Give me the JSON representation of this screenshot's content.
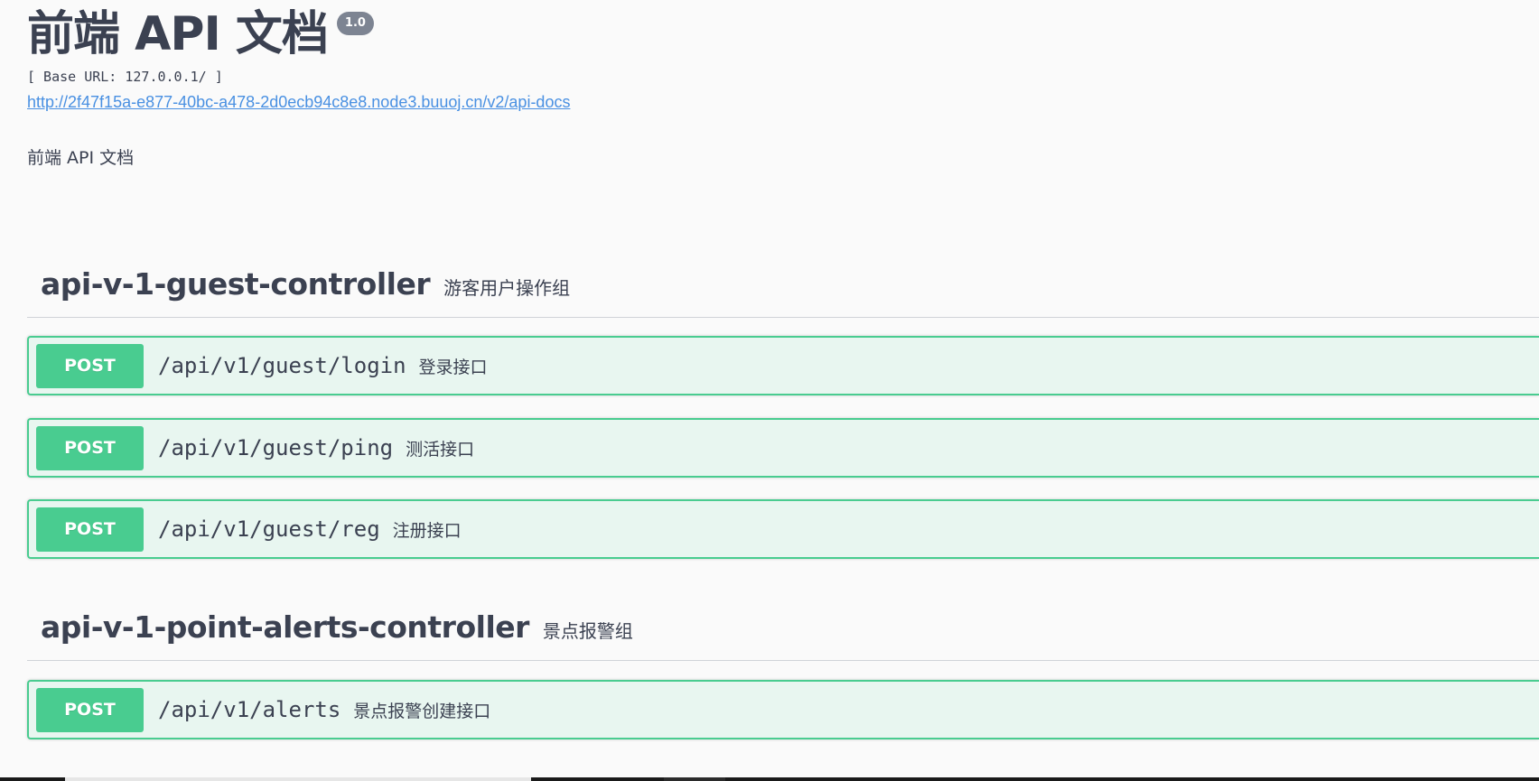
{
  "info": {
    "title": "前端 API 文档",
    "version": "1.0",
    "base_url": "[ Base URL: 127.0.0.1/ ]",
    "api_docs_link": "http://2f47f15a-e877-40bc-a478-2d0ecb94c8e8.node3.buuoj.cn/v2/api-docs",
    "description": "前端 API 文档"
  },
  "tags": [
    {
      "name": "api-v-1-guest-controller",
      "description": "游客用户操作组",
      "operations": [
        {
          "method": "POST",
          "path": "/api/v1/guest/login",
          "summary": "登录接口"
        },
        {
          "method": "POST",
          "path": "/api/v1/guest/ping",
          "summary": "测活接口"
        },
        {
          "method": "POST",
          "path": "/api/v1/guest/reg",
          "summary": "注册接口"
        }
      ]
    },
    {
      "name": "api-v-1-point-alerts-controller",
      "description": "景点报警组",
      "operations": [
        {
          "method": "POST",
          "path": "/api/v1/alerts",
          "summary": "景点报警创建接口"
        }
      ]
    }
  ],
  "colors": {
    "post_accent": "#49cc90",
    "post_background": "#e8f6f0",
    "text": "#3b4151",
    "link": "#4990e2"
  }
}
